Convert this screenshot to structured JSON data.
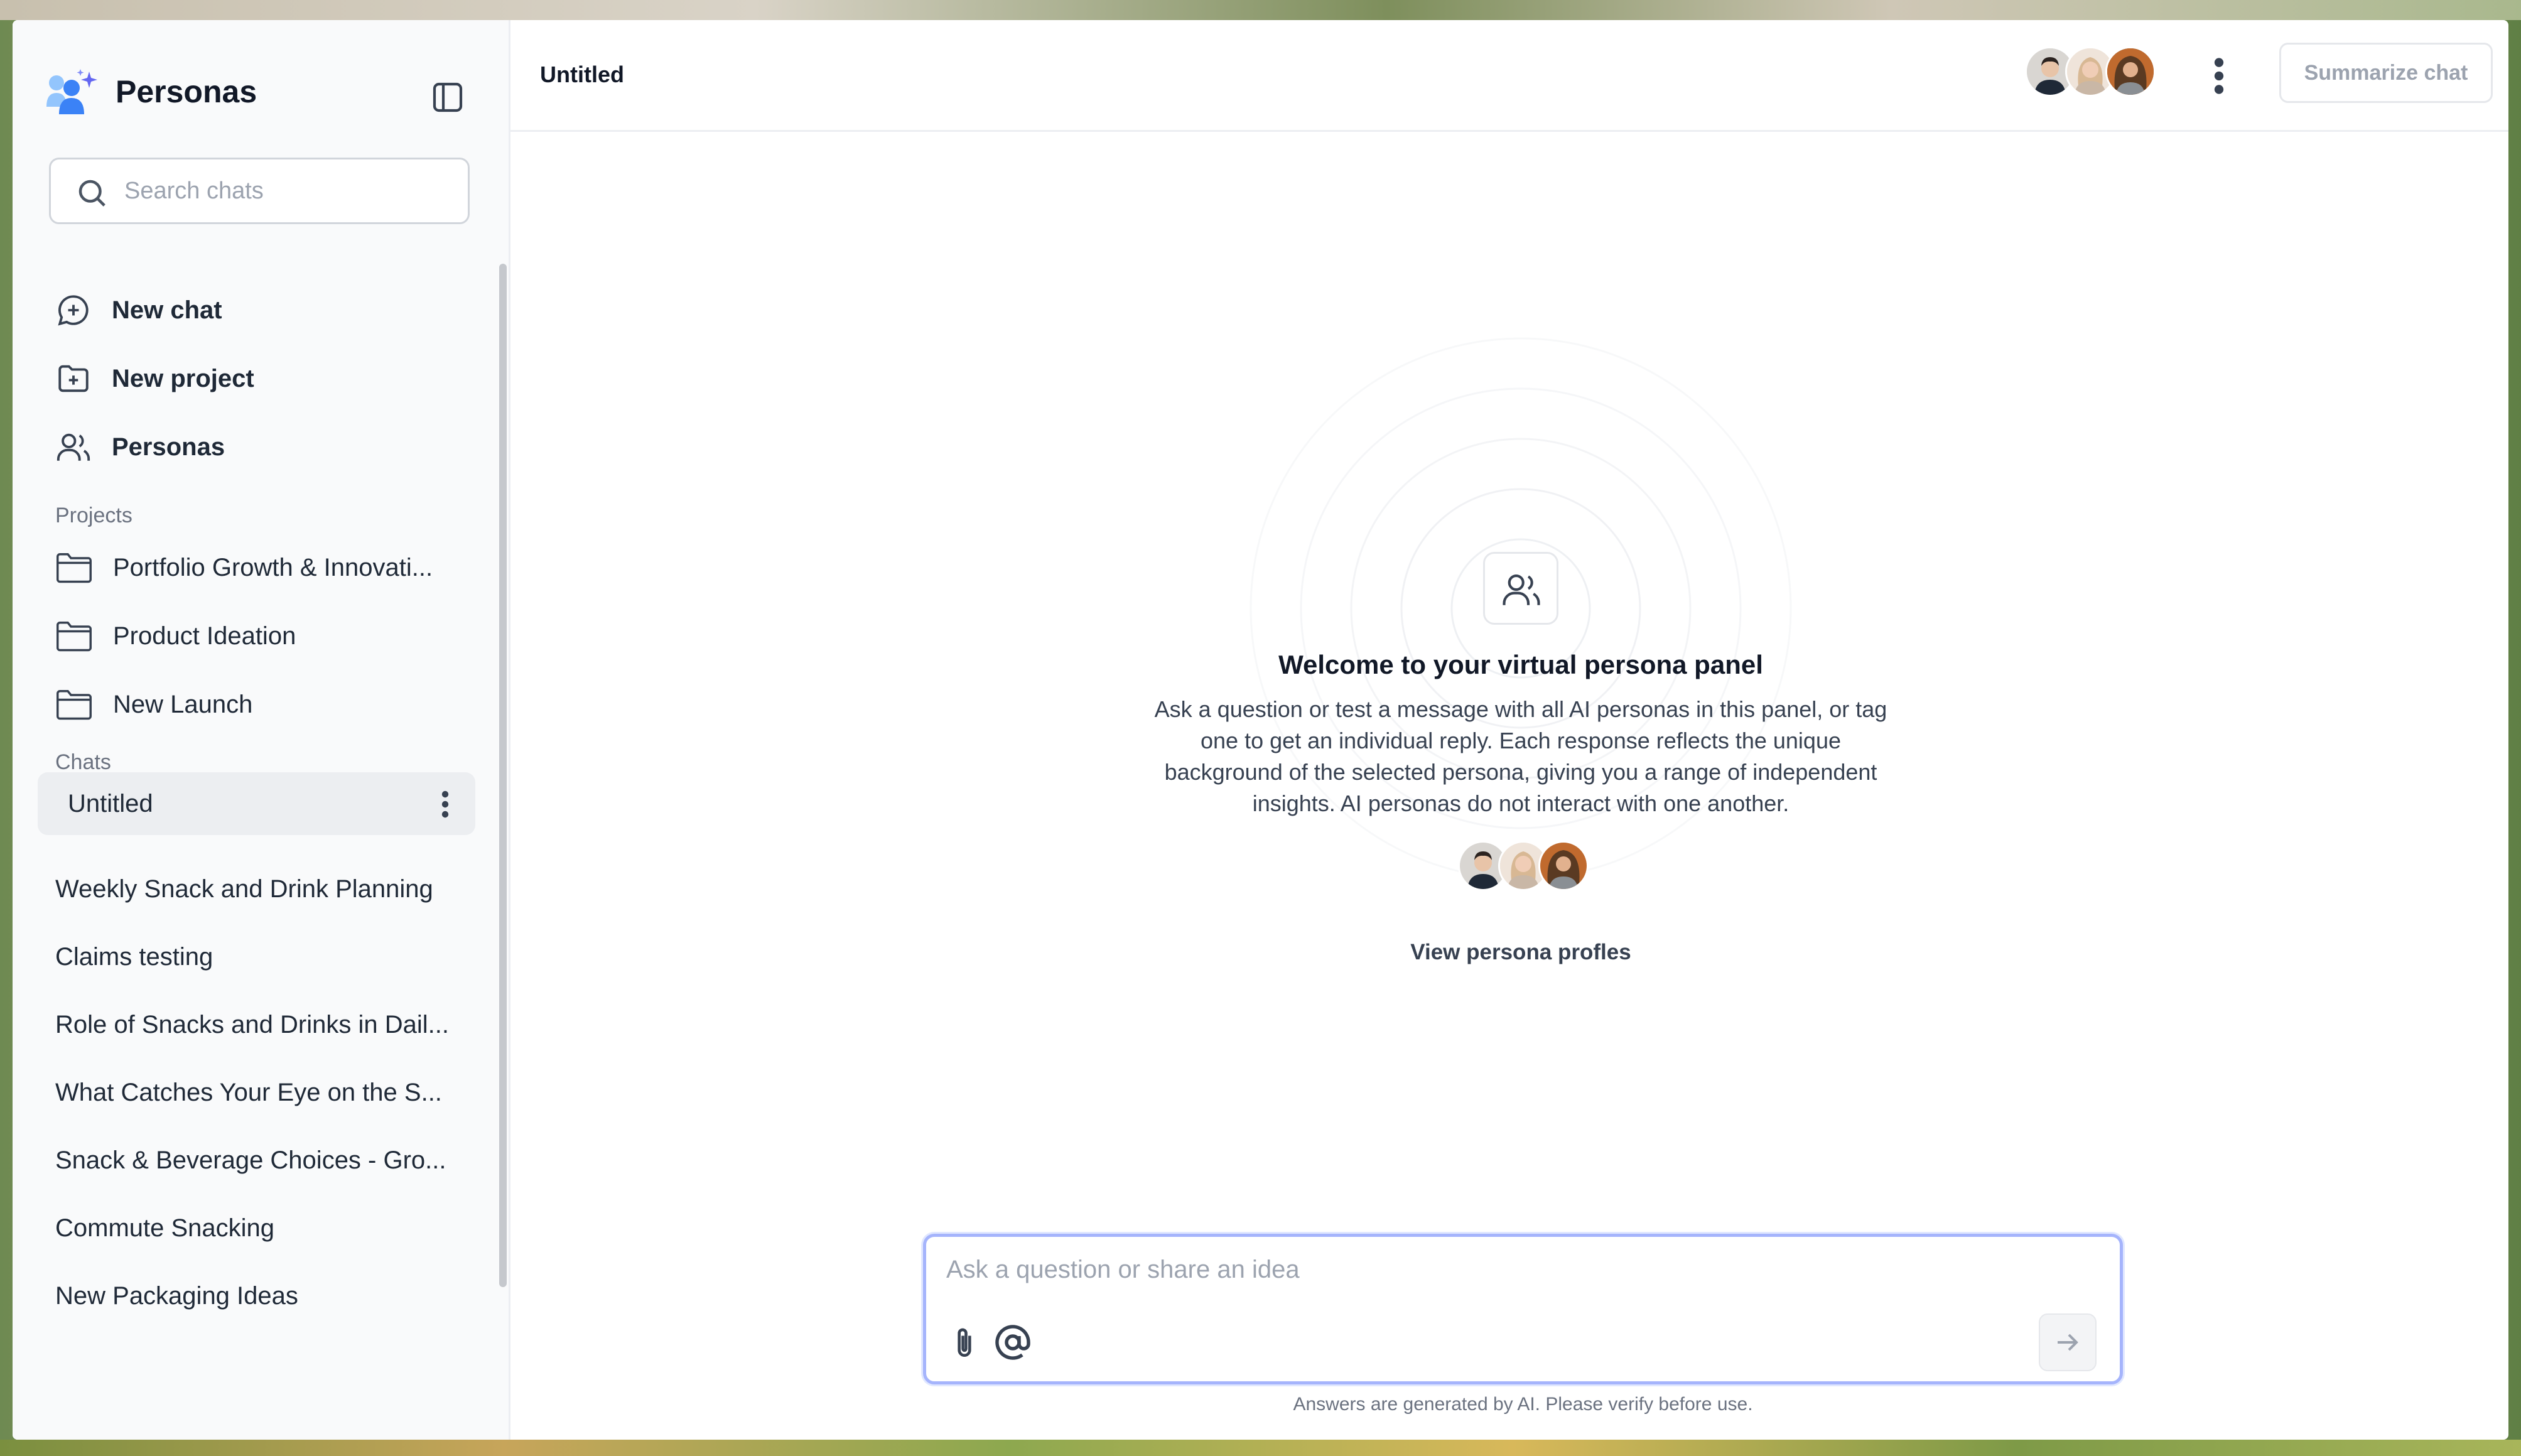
{
  "sidebar": {
    "brand": "Personas",
    "search_placeholder": "Search chats",
    "nav": [
      {
        "label": "New chat",
        "icon": "chat-plus-icon"
      },
      {
        "label": "New project",
        "icon": "folder-plus-icon"
      },
      {
        "label": "Personas",
        "icon": "users-icon"
      }
    ],
    "projects_label": "Projects",
    "projects": [
      {
        "label": "Portfolio Growth & Innovati..."
      },
      {
        "label": "Product Ideation"
      },
      {
        "label": "New Launch"
      }
    ],
    "chats_label": "Chats",
    "chats": [
      {
        "label": "Untitled",
        "active": true
      },
      {
        "label": "Weekly Snack and Drink Planning"
      },
      {
        "label": "Claims testing"
      },
      {
        "label": "Role of Snacks and Drinks in Dail..."
      },
      {
        "label": "What Catches Your Eye on the S..."
      },
      {
        "label": "Snack & Beverage Choices - Gro..."
      },
      {
        "label": "Commute Snacking"
      },
      {
        "label": "New Packaging Ideas"
      }
    ]
  },
  "header": {
    "title": "Untitled",
    "summarize_label": "Summarize chat"
  },
  "welcome": {
    "title": "Welcome to your virtual persona panel",
    "text": "Ask a question or test a message with all AI personas in this panel, or tag one to get an individual reply. Each response reflects the unique background of the selected persona, giving you a range of independent insights. AI personas do not interact with one another.",
    "link_label": "View persona profles"
  },
  "composer": {
    "placeholder": "Ask a question or share an idea",
    "disclaimer": "Answers are generated by AI. Please verify before use."
  },
  "colors": {
    "accent": "#a5b4fc",
    "logo_blue": "#3b82f6",
    "logo_light": "#93c5fd"
  }
}
